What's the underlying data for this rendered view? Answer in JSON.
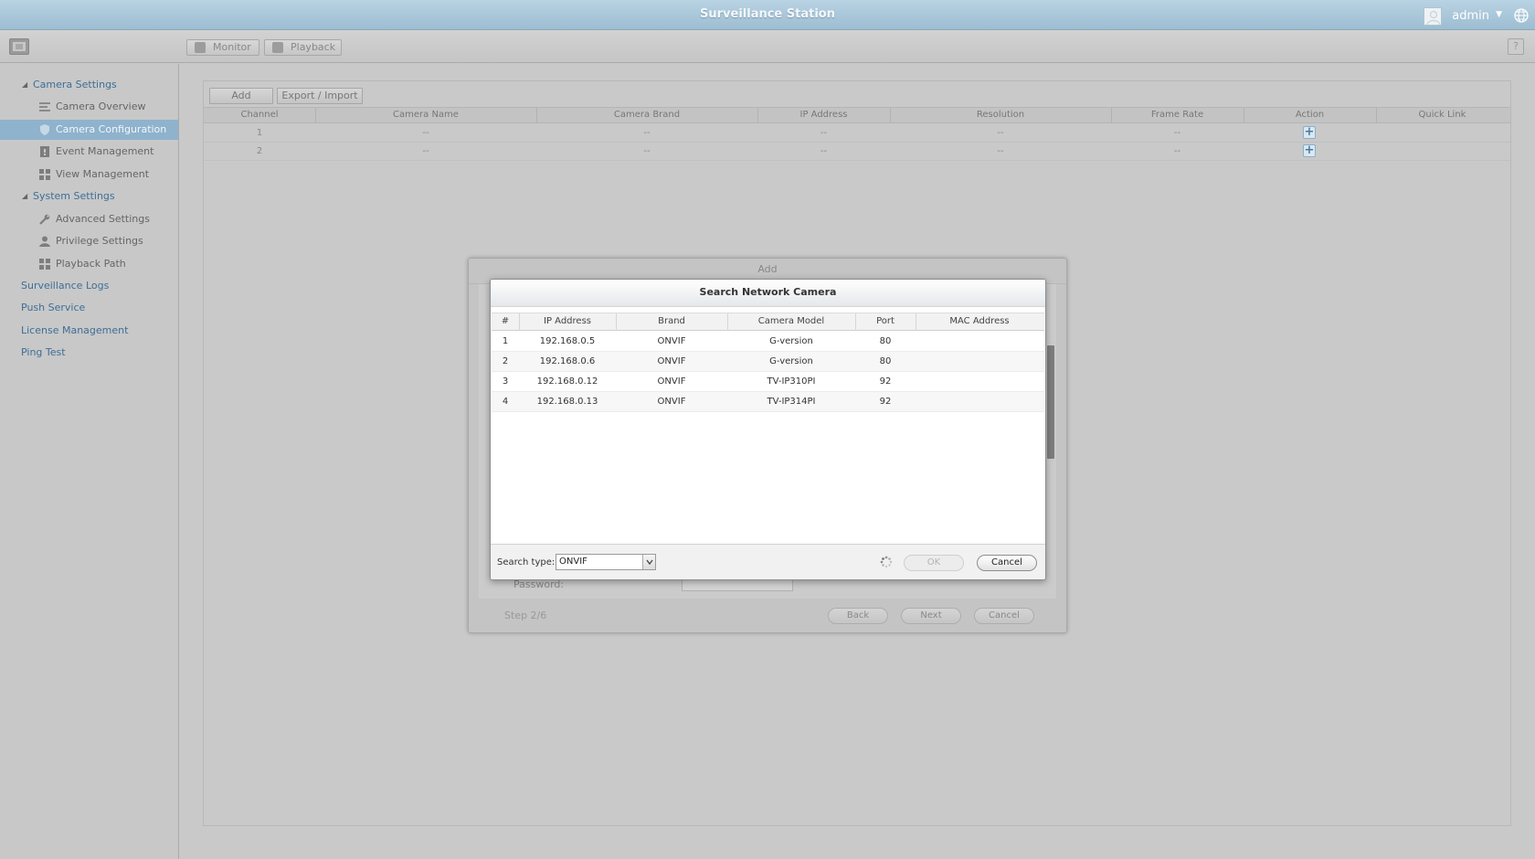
{
  "window": {
    "title": "Surveillance Station",
    "user": "admin"
  },
  "toolbar": {
    "monitor_label": "Monitor",
    "playback_label": "Playback",
    "help_label": "?"
  },
  "sidebar": {
    "camera_settings": "Camera Settings",
    "camera_overview": "Camera Overview",
    "camera_configuration": "Camera Configuration",
    "event_management": "Event Management",
    "view_management": "View Management",
    "system_settings": "System Settings",
    "advanced_settings": "Advanced Settings",
    "privilege_settings": "Privilege Settings",
    "playback_path": "Playback Path",
    "surveillance_logs": "Surveillance Logs",
    "push_service": "Push Service",
    "license_management": "License Management",
    "ping_test": "Ping Test"
  },
  "main": {
    "add_label": "Add",
    "export_import_label": "Export / Import",
    "columns": [
      "Channel",
      "Camera Name",
      "Camera Brand",
      "IP Address",
      "Resolution",
      "Frame Rate",
      "Action",
      "Quick Link"
    ],
    "rows": [
      {
        "channel": "1",
        "name": "--",
        "brand": "--",
        "ip": "--",
        "resolution": "--",
        "frame_rate": "--"
      },
      {
        "channel": "2",
        "name": "--",
        "brand": "--",
        "ip": "--",
        "resolution": "--",
        "frame_rate": "--"
      }
    ],
    "action_icon": "+"
  },
  "add_dialog": {
    "title": "Add",
    "password_label": "Password:",
    "step_text": "Step 2/6",
    "back_label": "Back",
    "next_label": "Next",
    "cancel_label": "Cancel"
  },
  "search_dialog": {
    "title": "Search Network Camera",
    "columns": [
      "#",
      "IP Address",
      "Brand",
      "Camera Model",
      "Port",
      "MAC Address"
    ],
    "rows": [
      {
        "num": "1",
        "ip": "192.168.0.5",
        "brand": "ONVIF",
        "model": "G-version",
        "port": "80",
        "mac": ""
      },
      {
        "num": "2",
        "ip": "192.168.0.6",
        "brand": "ONVIF",
        "model": "G-version",
        "port": "80",
        "mac": ""
      },
      {
        "num": "3",
        "ip": "192.168.0.12",
        "brand": "ONVIF",
        "model": "TV-IP310PI",
        "port": "92",
        "mac": ""
      },
      {
        "num": "4",
        "ip": "192.168.0.13",
        "brand": "ONVIF",
        "model": "TV-IP314PI",
        "port": "92",
        "mac": ""
      }
    ],
    "search_type_label": "Search type:",
    "search_type_value": "ONVIF",
    "ok_label": "OK",
    "cancel_label": "Cancel"
  },
  "colors": {
    "accent": "#8fb2cd",
    "link": "#3e6e96",
    "titlebar": "#a9c6d9"
  }
}
